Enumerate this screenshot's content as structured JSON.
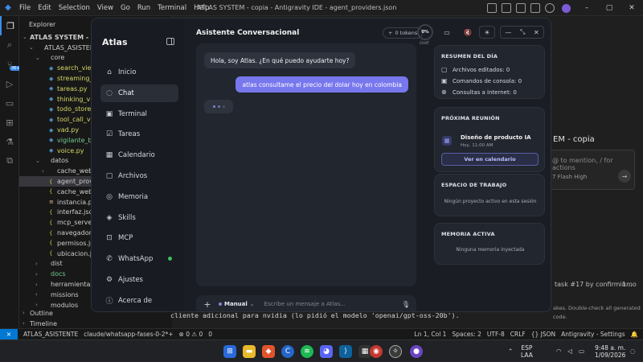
{
  "ide": {
    "menu": [
      "File",
      "Edit",
      "Selection",
      "View",
      "Go",
      "Run",
      "Terminal",
      "Help"
    ],
    "window_title": "ATLAS SYSTEM - copia - Antigravity IDE - agent_providers.json",
    "explorer_header": "Explorer",
    "tree": [
      {
        "label": "ATLAS SYSTEM - copia",
        "type": "root",
        "indent": 0,
        "chev": "⌄"
      },
      {
        "label": "ATLAS_ASISTENTE",
        "type": "dir",
        "indent": 1,
        "chev": "⌄"
      },
      {
        "label": "core",
        "type": "dir",
        "indent": 2,
        "chev": "⌄"
      },
      {
        "label": "search_view.py",
        "type": "py",
        "indent": 3
      },
      {
        "label": "streaming_con...",
        "type": "py",
        "indent": 3
      },
      {
        "label": "tareas.py",
        "type": "py",
        "indent": 3
      },
      {
        "label": "thinking_view.py",
        "type": "py",
        "indent": 3
      },
      {
        "label": "todo_store.py",
        "type": "py",
        "indent": 3
      },
      {
        "label": "tool_call_view.py",
        "type": "py",
        "indent": 3
      },
      {
        "label": "vad.py",
        "type": "py",
        "indent": 3
      },
      {
        "label": "vigilante_bucle...",
        "type": "pygreen",
        "indent": 3
      },
      {
        "label": "voice.py",
        "type": "py",
        "indent": 3
      },
      {
        "label": "datos",
        "type": "dir",
        "indent": 2,
        "chev": "⌄"
      },
      {
        "label": "cache_web",
        "type": "dir",
        "indent": 3,
        "chev": "›"
      },
      {
        "label": "agent_provider...",
        "type": "json",
        "indent": 3,
        "selected": true
      },
      {
        "label": "cache_web.json",
        "type": "json",
        "indent": 3
      },
      {
        "label": "instancia.pid",
        "type": "file",
        "indent": 3
      },
      {
        "label": "interfaz.json",
        "type": "json",
        "indent": 3
      },
      {
        "label": "mcp_servers.json",
        "type": "json",
        "indent": 3
      },
      {
        "label": "navegador.json",
        "type": "json",
        "indent": 3
      },
      {
        "label": "permisos.json",
        "type": "json",
        "indent": 3
      },
      {
        "label": "ubicacion.json",
        "type": "json",
        "indent": 3
      },
      {
        "label": "dist",
        "type": "dir",
        "indent": 2,
        "chev": "›"
      },
      {
        "label": "docs",
        "type": "dirgreen",
        "indent": 2,
        "chev": "›"
      },
      {
        "label": "herramientas",
        "type": "dir",
        "indent": 2,
        "chev": "›"
      },
      {
        "label": "missions",
        "type": "dir",
        "indent": 2,
        "chev": "›"
      },
      {
        "label": "modulos",
        "type": "dir",
        "indent": 2,
        "chev": "›"
      }
    ],
    "outline": "Outline",
    "timeline": "Timeline",
    "terminal_line": "cliente adicional para nvidia (lo pidió el modelo 'openai/gpt-oss-20b').",
    "side": {
      "title": "EM - copia",
      "placeholder": "@ to mention, / for actions",
      "model": "7 Flash High",
      "task": "task #17 by confirmin...",
      "task_meta": "1mo",
      "note": "akes. Double-check all generated",
      "note2": "code."
    },
    "status": {
      "remote": "⨯",
      "workspace": "ATLAS_ASISTENTE",
      "branch": "claude/whatsapp-fases-0-2*+",
      "problems": "⊗ 0 ⚠ 0",
      "ports": "0",
      "position": "Ln 1, Col 1",
      "spaces": "Spaces: 2",
      "encoding": "UTF-8",
      "eol": "CRLF",
      "lang": "{} JSON",
      "settings": "Antigravity - Settings"
    },
    "taskbar": {
      "lang": "ESP",
      "lang2": "LAA",
      "time": "9:48 a. m.",
      "date": "1/09/2026"
    }
  },
  "atlas": {
    "brand": "Atlas",
    "nav": [
      {
        "label": "Inicio",
        "icon": "⌂"
      },
      {
        "label": "Chat",
        "icon": "◌",
        "active": true
      },
      {
        "label": "Terminal",
        "icon": "▣"
      },
      {
        "label": "Tareas",
        "icon": "☑"
      },
      {
        "label": "Calendario",
        "icon": "▦"
      },
      {
        "label": "Archivos",
        "icon": "▢"
      },
      {
        "label": "Memoria",
        "icon": "◎"
      },
      {
        "label": "Skills",
        "icon": "◈"
      },
      {
        "label": "MCP",
        "icon": "⊡"
      },
      {
        "label": "WhatsApp",
        "icon": "✆",
        "online": true
      },
      {
        "label": "Ajustes",
        "icon": "⚙"
      },
      {
        "label": "Acerca de",
        "icon": "ⓘ"
      }
    ],
    "header": {
      "title": "Asistente Conversacional",
      "tokens": "0 tokens",
      "percent": "0%",
      "percent_label": "CHAT"
    },
    "messages": {
      "assistant": "Hola, soy Atlas. ¿En qué puedo ayudarte hoy?",
      "user": "atlas consultame el precio del dolar hoy en colombia"
    },
    "input": {
      "mode": "Manual",
      "placeholder": "Escribe un mensaje a Atlas..."
    },
    "summary": {
      "title": "RESUMEN DEL DÍA",
      "lines": [
        {
          "icon": "▢",
          "text": "Archivos editados: 0"
        },
        {
          "icon": "▣",
          "text": "Comandos de consola: 0"
        },
        {
          "icon": "⊕",
          "text": "Consultas a internet: 0"
        }
      ]
    },
    "meeting": {
      "title": "PRÓXIMA REUNIÓN",
      "name": "Diseño de producto IA",
      "time": "Hoy, 11:00 AM",
      "button": "Ver en calendario"
    },
    "workspace": {
      "title": "ESPACIO DE TRABAJO",
      "empty": "Ningún proyecto activo en esta sesión"
    },
    "memory": {
      "title": "MEMORIA ACTIVA",
      "empty": "Ninguna memoria inyectada"
    }
  }
}
